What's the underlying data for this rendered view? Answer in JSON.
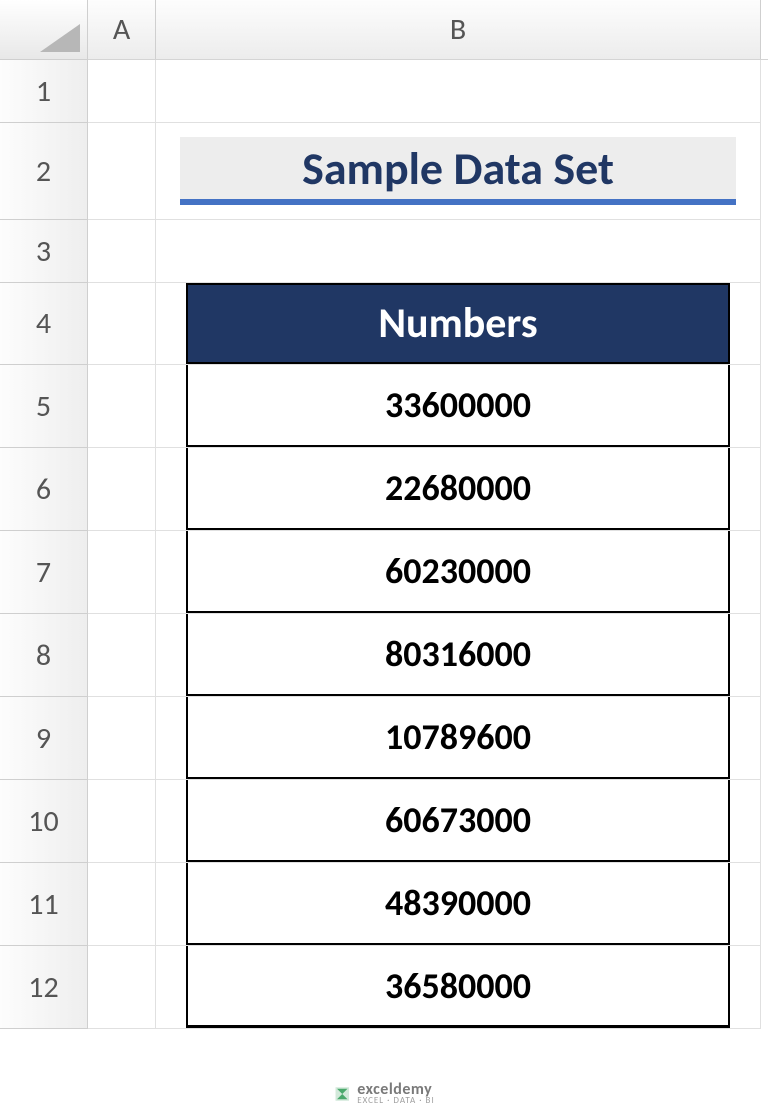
{
  "columns": {
    "A": "A",
    "B": "B"
  },
  "rows": [
    "1",
    "2",
    "3",
    "4",
    "5",
    "6",
    "7",
    "8",
    "9",
    "10",
    "11",
    "12"
  ],
  "title": "Sample Data Set",
  "table": {
    "header": "Numbers",
    "values": [
      "33600000",
      "22680000",
      "60230000",
      "80316000",
      "10789600",
      "60673000",
      "48390000",
      "36580000"
    ]
  },
  "watermark": {
    "main": "exceldemy",
    "sub": "EXCEL · DATA · BI"
  }
}
